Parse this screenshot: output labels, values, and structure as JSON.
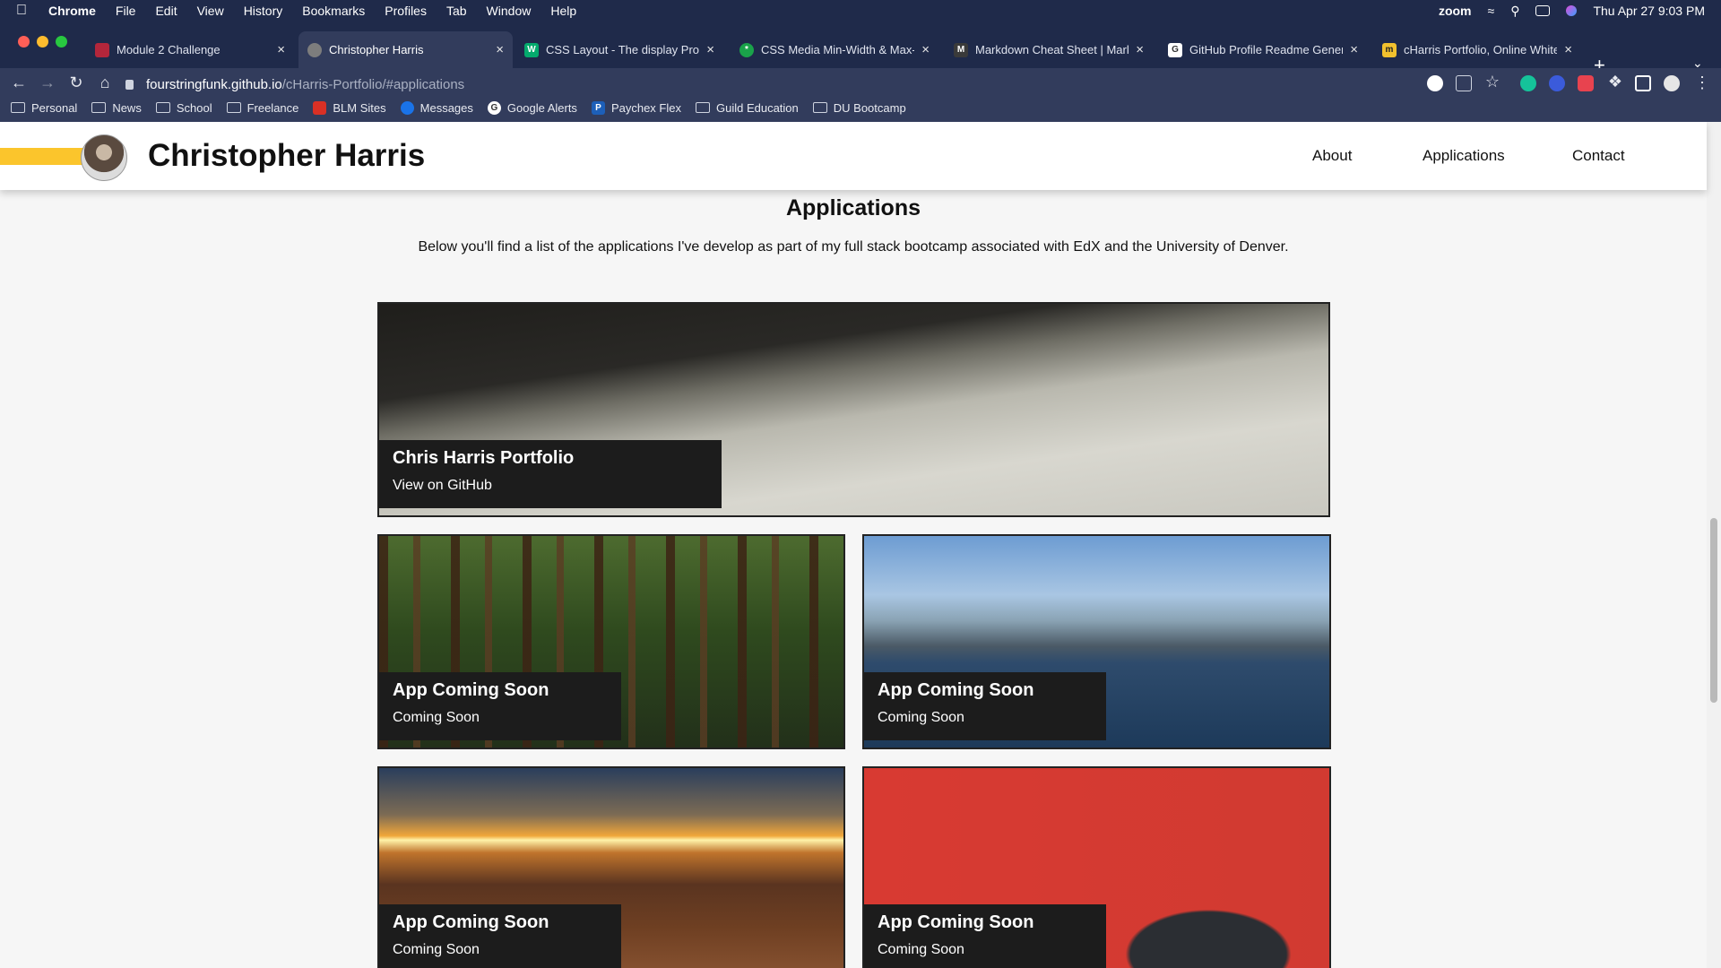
{
  "menubar": {
    "app": "Chrome",
    "items": [
      "File",
      "Edit",
      "View",
      "History",
      "Bookmarks",
      "Profiles",
      "Tab",
      "Window",
      "Help"
    ],
    "status_zoom": "zoom",
    "clock": "Thu Apr 27  9:03 PM"
  },
  "tabs": [
    {
      "label": "Module 2 Challenge",
      "favicon_color": "#b3263b"
    },
    {
      "label": "Christopher Harris",
      "favicon_color": "#7d7d7d"
    },
    {
      "label": "CSS Layout - The display Prop",
      "favicon_color": "#04aa6d"
    },
    {
      "label": "CSS Media Min-Width & Max-W",
      "favicon_color": "#1aa34a"
    },
    {
      "label": "Markdown Cheat Sheet | Markd",
      "favicon_color": "#3a3a3a"
    },
    {
      "label": "GitHub Profile Readme Genera",
      "favicon_color": "#ffffff"
    },
    {
      "label": "cHarris Portfolio, Online Whitel",
      "favicon_color": "#f2c12e"
    }
  ],
  "toolbar": {
    "url_host": "fourstringfunk.github.io",
    "url_path": "/cHarris-Portfolio/#applications"
  },
  "bookmarks": [
    {
      "label": "Personal",
      "type": "folder"
    },
    {
      "label": "News",
      "type": "folder"
    },
    {
      "label": "School",
      "type": "folder"
    },
    {
      "label": "Freelance",
      "type": "folder"
    },
    {
      "label": "BLM Sites",
      "type": "icon",
      "color": "#d93025"
    },
    {
      "label": "Messages",
      "type": "icon",
      "color": "#1a73e8"
    },
    {
      "label": "Google Alerts",
      "type": "icon",
      "color": "#ffffff"
    },
    {
      "label": "Paychex Flex",
      "type": "icon",
      "color": "#1d5fb8"
    },
    {
      "label": "Guild Education",
      "type": "folder"
    },
    {
      "label": "DU Bootcamp",
      "type": "folder"
    }
  ],
  "site": {
    "name": "Christopher Harris",
    "nav": [
      "About",
      "Applications",
      "Contact"
    ],
    "accent": "#fbc52c"
  },
  "applications": {
    "title": "Applications",
    "description": "Below you'll find a list of the applications I've develop as part of my full stack bootcamp associated with EdX and the University of Denver.",
    "cards": [
      {
        "title": "Chris Harris Portfolio",
        "subtitle": "View on GitHub"
      },
      {
        "title": "App Coming Soon",
        "subtitle": "Coming Soon"
      },
      {
        "title": "App Coming Soon",
        "subtitle": "Coming Soon"
      },
      {
        "title": "App Coming Soon",
        "subtitle": "Coming Soon"
      },
      {
        "title": "App Coming Soon",
        "subtitle": "Coming Soon"
      }
    ]
  }
}
